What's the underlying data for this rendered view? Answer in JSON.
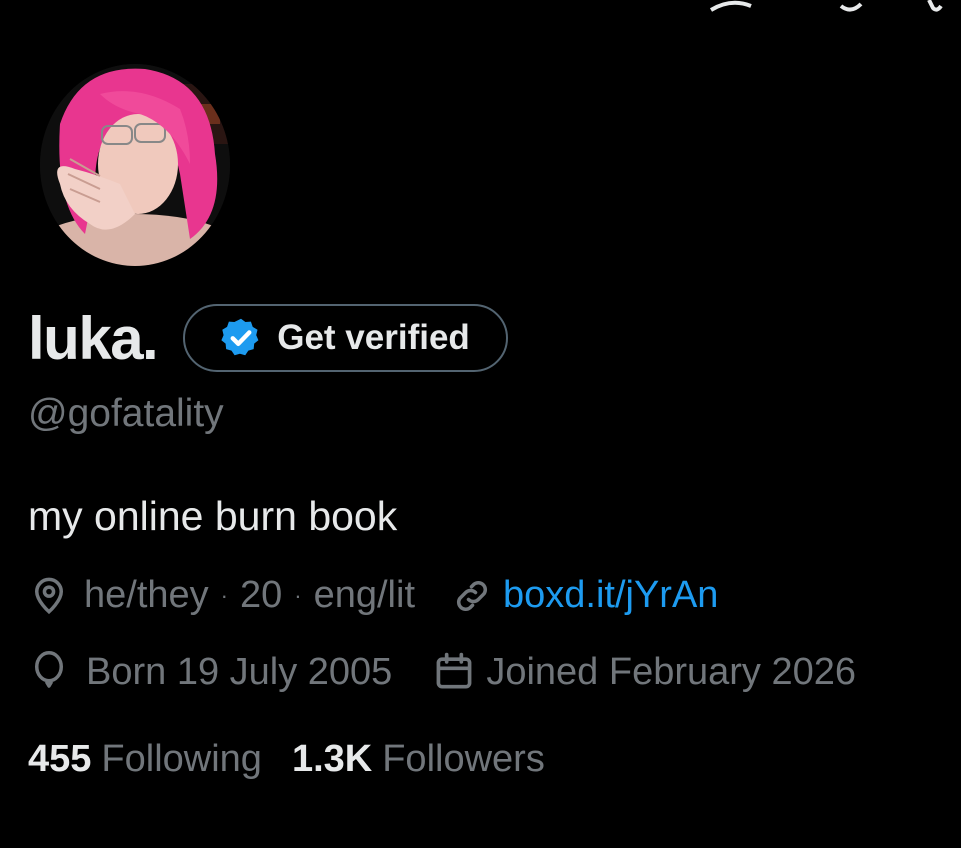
{
  "profile": {
    "display_name": "luka.",
    "verify_label": "Get verified",
    "handle": "@gofatality",
    "bio": "my online burn book",
    "location": {
      "pronouns": "he/they",
      "sep": "·",
      "age": "20",
      "field": "eng/lit"
    },
    "link": "boxd.it/jYrAn",
    "birthday": "Born 19 July 2005",
    "joined": "Joined February 2026",
    "following_count": "455",
    "following_label": "Following",
    "followers_count": "1.3K",
    "followers_label": "Followers"
  },
  "colors": {
    "background": "#000000",
    "primary_text": "#e7e9ea",
    "secondary_text": "#71767b",
    "link": "#1d9bf0",
    "verified_badge": "#1d9bf0",
    "avatar_hair": "#e8368f"
  }
}
